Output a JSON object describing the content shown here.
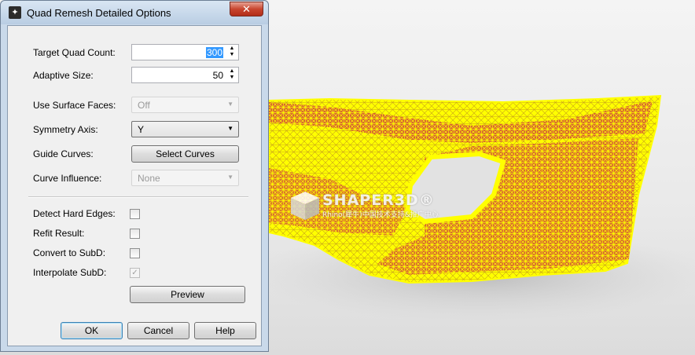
{
  "window": {
    "title": "Quad Remesh Detailed Options",
    "close_glyph": "✕"
  },
  "fields": {
    "target_quad_count": {
      "label": "Target Quad Count:",
      "value": "300"
    },
    "adaptive_size": {
      "label": "Adaptive Size:",
      "value": "50"
    },
    "use_surface_faces": {
      "label": "Use Surface Faces:",
      "value": "Off",
      "enabled": false
    },
    "symmetry_axis": {
      "label": "Symmetry Axis:",
      "value": "Y",
      "enabled": true
    },
    "guide_curves": {
      "label": "Guide Curves:",
      "button": "Select Curves"
    },
    "curve_influence": {
      "label": "Curve Influence:",
      "value": "None",
      "enabled": false
    }
  },
  "checkboxes": {
    "detect_hard_edges": {
      "label": "Detect Hard Edges:",
      "checked": false
    },
    "refit_result": {
      "label": "Refit Result:",
      "checked": false
    },
    "convert_to_subd": {
      "label": "Convert to SubD:",
      "checked": false
    },
    "interpolate_subd": {
      "label": "Interpolate SubD:",
      "checked": true,
      "enabled": false,
      "mark": "✓"
    }
  },
  "buttons": {
    "preview": "Preview",
    "ok": "OK",
    "cancel": "Cancel",
    "help": "Help"
  },
  "viewport": {
    "watermark": "SHAPER3D®",
    "watermark_sub": "Rhino(犀牛)中国技术支持&推广中心",
    "mesh_fill": "#ffff00",
    "mesh_face": "#d2483a"
  },
  "colors": {
    "titlebar_top": "#d9e6f3",
    "titlebar_bottom": "#b9cde3",
    "selection": "#3399ff"
  }
}
